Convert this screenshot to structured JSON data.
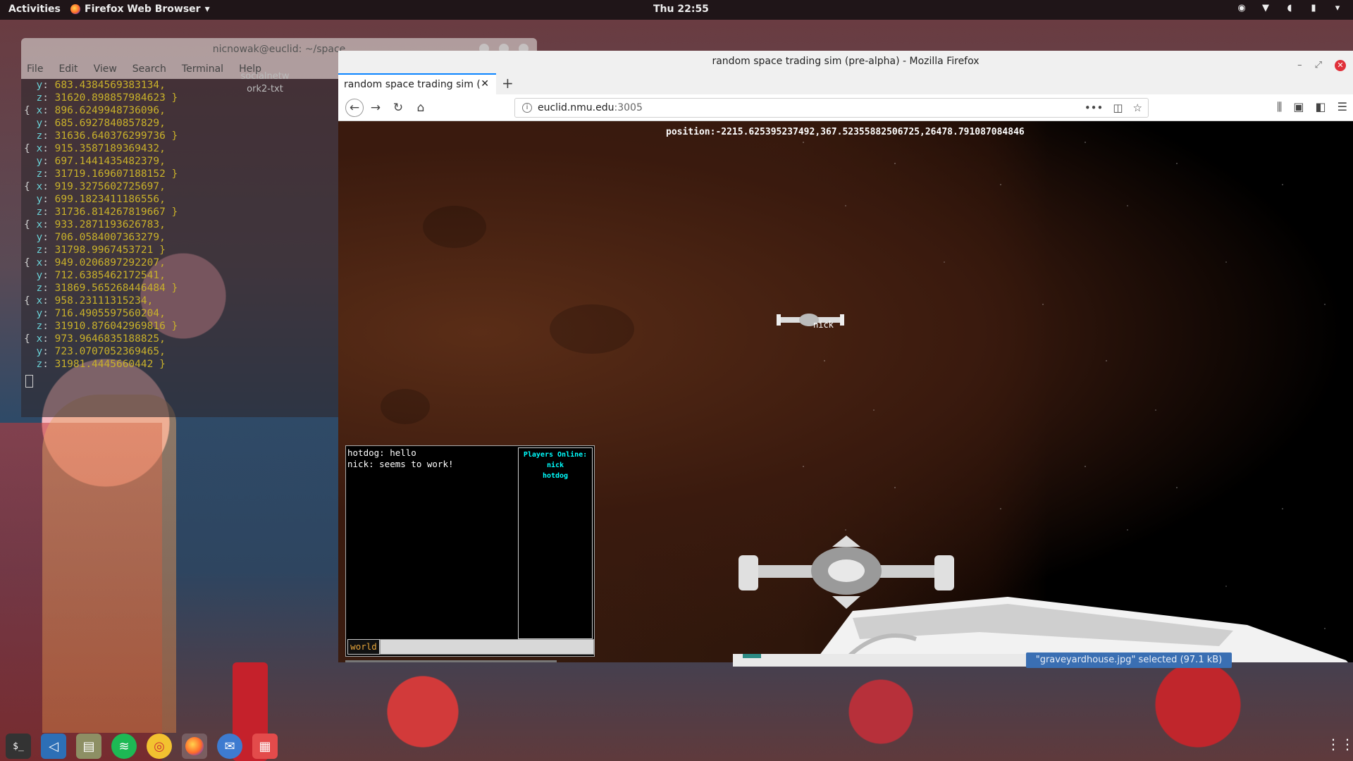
{
  "topbar": {
    "activities": "Activities",
    "app_menu": "Firefox Web Browser",
    "clock": "Thu 22:55"
  },
  "terminal": {
    "title": "nicnowak@euclid: ~/space",
    "menu": [
      "File",
      "Edit",
      "View",
      "Search",
      "Terminal",
      "Help"
    ],
    "desktop_icon_label": "socialnetw ork2-txt",
    "lines": [
      {
        "prefix": "  ",
        "key": "y",
        "value": "683.4384569383134,"
      },
      {
        "prefix": "  ",
        "key": "z",
        "value": "31620.898857984623 }"
      },
      {
        "prefix": "{ ",
        "key": "x",
        "value": "896.6249948736096,"
      },
      {
        "prefix": "  ",
        "key": "y",
        "value": "685.6927840857829,"
      },
      {
        "prefix": "  ",
        "key": "z",
        "value": "31636.640376299736 }"
      },
      {
        "prefix": "{ ",
        "key": "x",
        "value": "915.3587189369432,"
      },
      {
        "prefix": "  ",
        "key": "y",
        "value": "697.1441435482379,"
      },
      {
        "prefix": "  ",
        "key": "z",
        "value": "31719.169607188152 }"
      },
      {
        "prefix": "{ ",
        "key": "x",
        "value": "919.3275602725697,"
      },
      {
        "prefix": "  ",
        "key": "y",
        "value": "699.1823411186556,"
      },
      {
        "prefix": "  ",
        "key": "z",
        "value": "31736.814267819667 }"
      },
      {
        "prefix": "{ ",
        "key": "x",
        "value": "933.2871193626783,"
      },
      {
        "prefix": "  ",
        "key": "y",
        "value": "706.0584007363279,"
      },
      {
        "prefix": "  ",
        "key": "z",
        "value": "31798.9967453721 }"
      },
      {
        "prefix": "{ ",
        "key": "x",
        "value": "949.0206897292207,"
      },
      {
        "prefix": "  ",
        "key": "y",
        "value": "712.6385462172541,"
      },
      {
        "prefix": "  ",
        "key": "z",
        "value": "31869.565268446484 }"
      },
      {
        "prefix": "{ ",
        "key": "x",
        "value": "958.23111315234,"
      },
      {
        "prefix": "  ",
        "key": "y",
        "value": "716.4905597560204,"
      },
      {
        "prefix": "  ",
        "key": "z",
        "value": "31910.876042969816 }"
      },
      {
        "prefix": "{ ",
        "key": "x",
        "value": "973.9646835188825,"
      },
      {
        "prefix": "  ",
        "key": "y",
        "value": "723.0707052369465,"
      },
      {
        "prefix": "  ",
        "key": "z",
        "value": "31981.4445660442 }"
      }
    ]
  },
  "firefox": {
    "window_title": "random space trading sim (pre-alpha) - Mozilla Firefox",
    "tab_title": "random space trading sim (",
    "url_host": "euclid.nmu.edu",
    "url_port": ":3005"
  },
  "game": {
    "position": "position:-2215.625395237492,367.52355882506725,26478.791087084846",
    "ship_label": "nick",
    "chat": {
      "messages": [
        "hotdog: hello",
        "nick: seems to work!"
      ],
      "players_header": "Players Online:",
      "players": [
        "nick",
        "hotdog"
      ],
      "channel": "world",
      "input_value": ""
    }
  },
  "notification": "\"graveyardhouse.jpg\" selected  (97.1 kB)",
  "dock": [
    "terminal-icon",
    "vscode-icon",
    "files-icon",
    "spotify-icon",
    "chromium-icon",
    "firefox-icon",
    "thunderbird-icon",
    "image-viewer-icon"
  ],
  "colors": {
    "firefox_accent": "#0a84ff",
    "terminal_key": "#6ad0d6",
    "terminal_number": "#c9b12a",
    "players_header": "#00ffff",
    "channel_label": "#e6a53a",
    "notification_bg": "#3a6fb3"
  }
}
